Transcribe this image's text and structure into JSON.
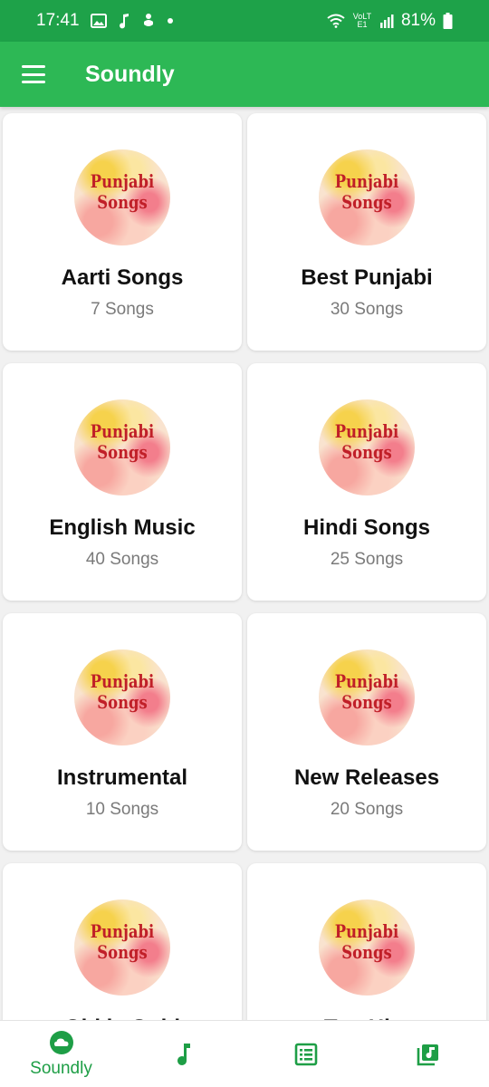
{
  "status_bar": {
    "time": "17:41",
    "left_icons": [
      "image-icon",
      "music-note-icon",
      "upload-icon",
      "dot-icon"
    ],
    "right_icons": [
      "wifi-icon",
      "volte-icon",
      "signal-icon"
    ],
    "volte_text": "VoLTE1",
    "battery": "81%"
  },
  "app_bar": {
    "title": "Soundly",
    "menu_icon": "menu-icon"
  },
  "cover_art": {
    "line1": "Punjabi",
    "line2": "Songs"
  },
  "playlists": [
    {
      "title": "Aarti Songs",
      "count": "7 Songs"
    },
    {
      "title": "Best Punjabi",
      "count": "30 Songs"
    },
    {
      "title": "English Music",
      "count": "40 Songs"
    },
    {
      "title": "Hindi Songs",
      "count": "25 Songs"
    },
    {
      "title": "Instrumental",
      "count": "10 Songs"
    },
    {
      "title": "New Releases",
      "count": "20 Songs"
    },
    {
      "title": "Old is Gold",
      "count": ""
    },
    {
      "title": "Top Hits",
      "count": ""
    }
  ],
  "bottom_nav": {
    "items": [
      {
        "icon": "cloud-icon",
        "label": "Soundly",
        "active": true
      },
      {
        "icon": "music-note-icon",
        "label": "",
        "active": false
      },
      {
        "icon": "list-icon",
        "label": "",
        "active": false
      },
      {
        "icon": "library-music-icon",
        "label": "",
        "active": false
      }
    ]
  },
  "colors": {
    "status_bar": "#1ea249",
    "app_bar": "#2db855",
    "accent": "#1e9e46"
  }
}
